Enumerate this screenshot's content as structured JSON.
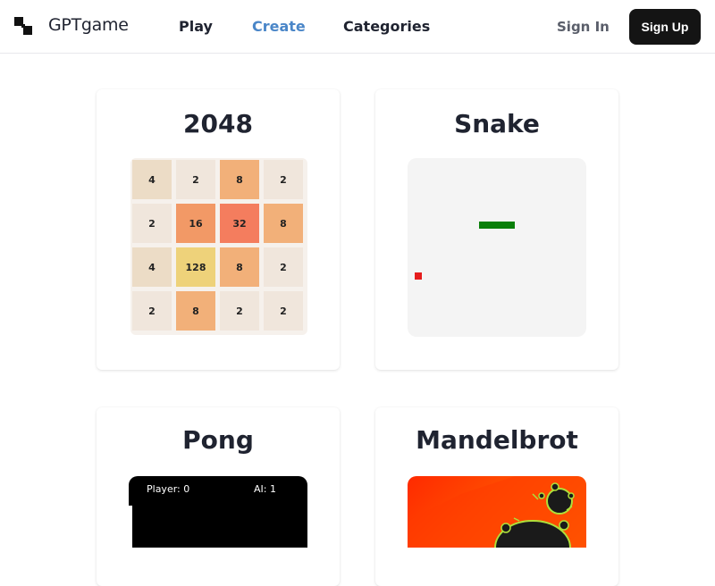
{
  "header": {
    "brand": "GPTgame",
    "nav": [
      {
        "label": "Play",
        "active": false
      },
      {
        "label": "Create",
        "active": true
      },
      {
        "label": "Categories",
        "active": false
      }
    ],
    "sign_in": "Sign In",
    "sign_up": "Sign Up"
  },
  "colors": {
    "accent": "#4a86c8",
    "dark": "#141414",
    "snake": "#0a7f0a",
    "food": "#e51c1c"
  },
  "games": [
    {
      "title": "2048",
      "grid": [
        [
          "4",
          "2",
          "8",
          "2"
        ],
        [
          "2",
          "16",
          "32",
          "8"
        ],
        [
          "4",
          "128",
          "8",
          "2"
        ],
        [
          "2",
          "8",
          "2",
          "2"
        ]
      ]
    },
    {
      "title": "Snake"
    },
    {
      "title": "Pong",
      "player_score": "Player: 0",
      "ai_score": "AI: 1"
    },
    {
      "title": "Mandelbrot"
    }
  ]
}
